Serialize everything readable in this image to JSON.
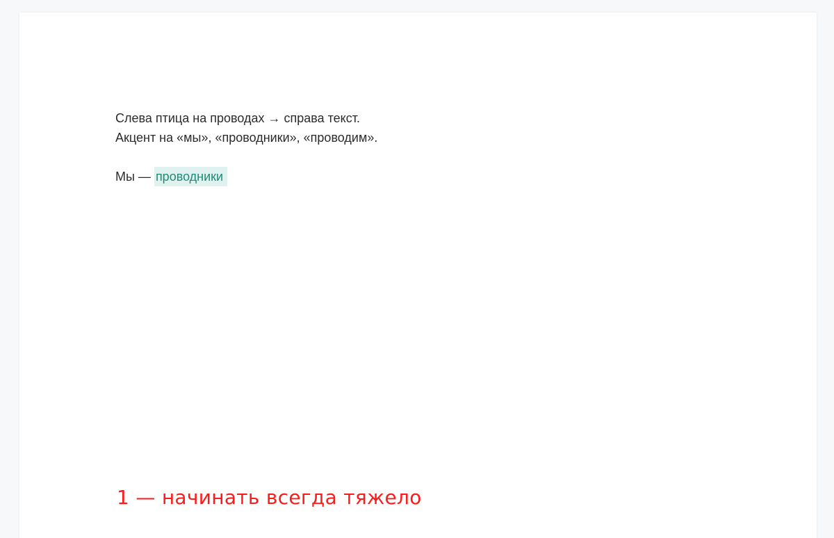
{
  "document": {
    "lines": [
      "Слева птица на проводах → справа текст.",
      "Акцент на «мы», «проводники», «проводим»."
    ],
    "we_prefix": "Мы — ",
    "we_highlight": "проводники",
    "caption": "1 — начинать всегда тяжело"
  },
  "colors": {
    "highlight_bg": "#dff2ef",
    "highlight_text": "#1f8b78",
    "caption": "#ff1a1a",
    "body_text": "#2b2b2b"
  }
}
